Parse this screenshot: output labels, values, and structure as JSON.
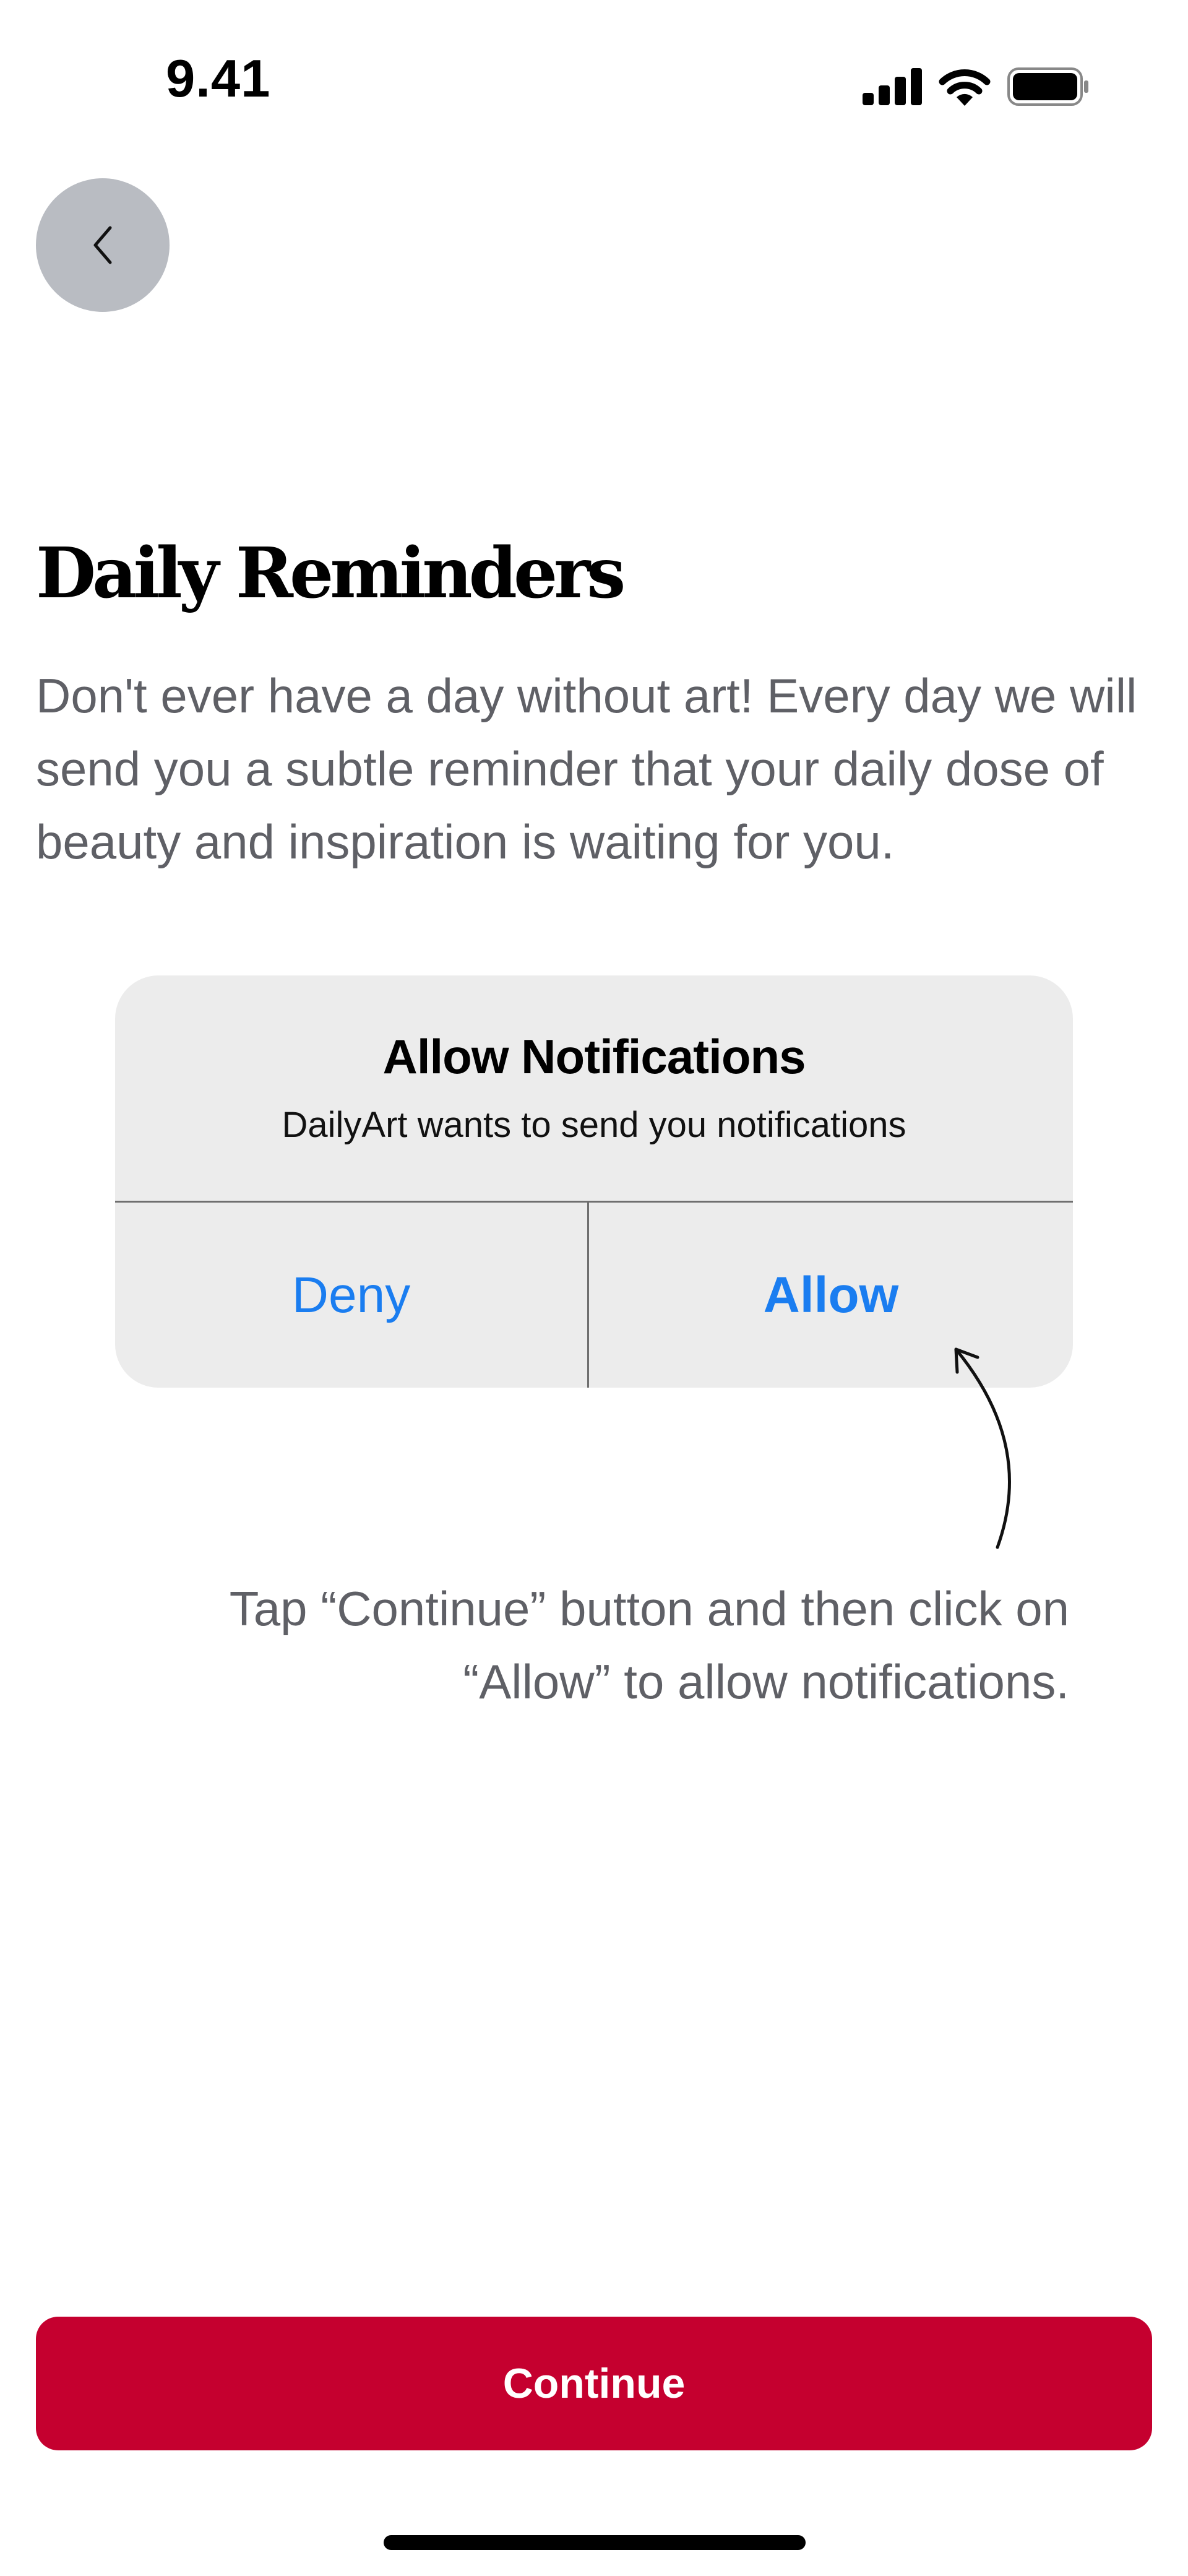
{
  "status_bar": {
    "time": "9.41",
    "icons": [
      "cellular-signal-icon",
      "wifi-icon",
      "battery-icon"
    ]
  },
  "nav": {
    "back_icon": "chevron-left-icon"
  },
  "content": {
    "title": "Daily Reminders",
    "description": "Don't ever have a day without art! Every day we will send you a subtle reminder that your daily dose of beauty and inspiration is waiting for you."
  },
  "dialog": {
    "title": "Allow Notifications",
    "subtitle": "DailyArt wants to send you notifications",
    "deny_label": "Deny",
    "allow_label": "Allow"
  },
  "hint": {
    "line1": "Tap “Continue” button and then click on",
    "line2": "“Allow” to allow notifications."
  },
  "footer": {
    "continue_label": "Continue"
  },
  "colors": {
    "accent_red": "#c5002f",
    "ios_blue": "#1a7df0",
    "back_button_bg": "#b9bcc2",
    "dialog_bg": "#ececec",
    "body_text_gray": "#5f6066"
  }
}
